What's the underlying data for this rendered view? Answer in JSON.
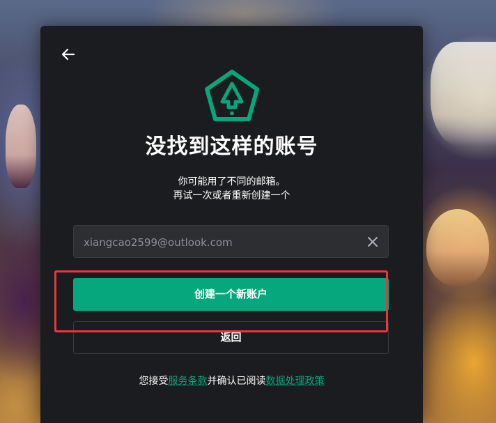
{
  "colors": {
    "accent": "#06a77d",
    "dialog_bg": "#1b1c1f",
    "input_bg": "#2d2e32",
    "highlight": "#e8393a"
  },
  "header": {
    "back_icon": "arrow-left-icon",
    "logo_icon": "pentagon-up-arrow-logo"
  },
  "main": {
    "title": "没找到这样的账号",
    "subtitle_line1": "你可能用了不同的邮箱。",
    "subtitle_line2": "再试一次或者重新创建一个"
  },
  "email": {
    "value": "xiangcao2599@outlook.com",
    "clear_icon": "close-icon"
  },
  "actions": {
    "create_label": "创建一个新账户",
    "back_label": "返回"
  },
  "terms": {
    "prefix": "您接受",
    "tos_link": "服务条款",
    "middle": "并确认已阅读",
    "privacy_link": "数据处理政策"
  }
}
